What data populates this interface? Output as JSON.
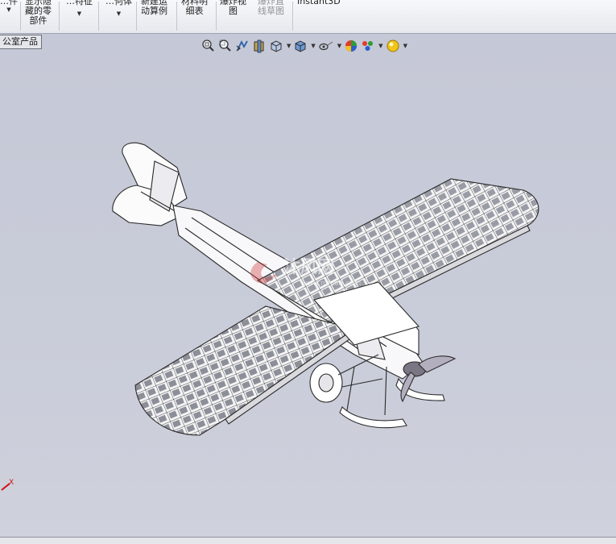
{
  "ribbon": {
    "items": [
      {
        "lines": [
          "…件"
        ],
        "has_arrow": true,
        "disabled": false
      },
      {
        "lines": [
          "显示隐",
          "藏的零",
          "部件"
        ],
        "has_arrow": false,
        "disabled": false
      },
      {
        "lines": [
          "…特征"
        ],
        "has_arrow": true,
        "disabled": false
      },
      {
        "lines": [
          "…何体"
        ],
        "has_arrow": true,
        "disabled": false
      },
      {
        "lines": [
          "新建运",
          "动算例"
        ],
        "has_arrow": false,
        "disabled": false
      },
      {
        "lines": [
          "材料明",
          "细表"
        ],
        "has_arrow": false,
        "disabled": false
      },
      {
        "lines": [
          "爆炸视",
          "图"
        ],
        "has_arrow": false,
        "disabled": false
      },
      {
        "lines": [
          "爆炸直",
          "线草图"
        ],
        "has_arrow": false,
        "disabled": true
      },
      {
        "lines": [
          "Instant3D"
        ],
        "has_arrow": false,
        "disabled": false
      }
    ]
  },
  "document_tab": {
    "label": "公室产品"
  },
  "hud_toolbar": {
    "icons": [
      "zoom-to-fit-icon",
      "zoom-to-area-icon",
      "previous-view-icon",
      "section-view-icon",
      "view-orientation-icon",
      "display-style-icon",
      "hide-show-items-icon",
      "edit-appearance-icon",
      "apply-scene-icon",
      "view-settings-icon"
    ]
  },
  "watermark": {
    "text": "沐风网",
    "url": "www.mfcad.com"
  },
  "axis_indicator": {
    "label": "X"
  },
  "colors": {
    "viewport_bg": "#c6c9d6",
    "axis_x": "#d01010",
    "model_line": "#2a2a2a",
    "panel_shading": "#8d8f98"
  }
}
